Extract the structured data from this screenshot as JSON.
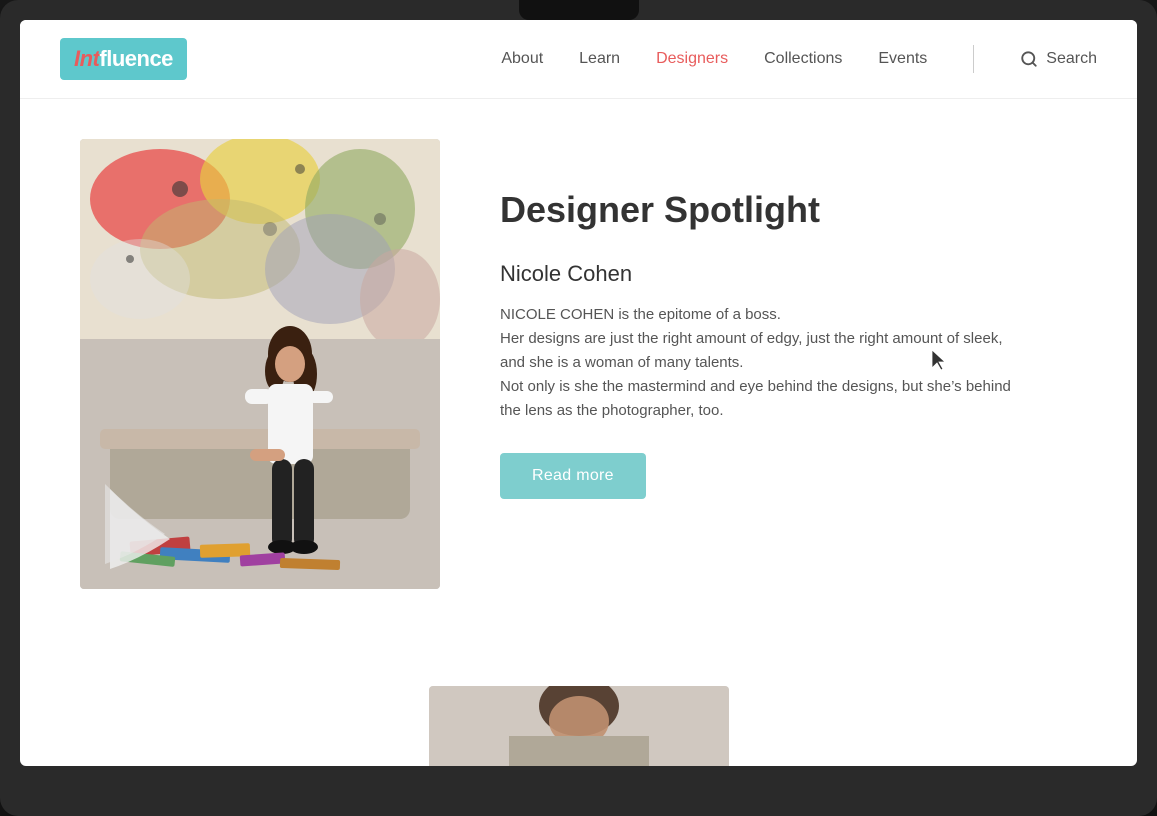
{
  "laptop": {
    "screen_bg": "#ffffff"
  },
  "nav": {
    "logo_int": "Int",
    "logo_fluence": "fluence",
    "links": [
      {
        "label": "About",
        "active": false,
        "id": "about"
      },
      {
        "label": "Learn",
        "active": false,
        "id": "learn"
      },
      {
        "label": "Designers",
        "active": true,
        "id": "designers"
      },
      {
        "label": "Collections",
        "active": false,
        "id": "collections"
      },
      {
        "label": "Events",
        "active": false,
        "id": "events"
      }
    ],
    "search_label": "Search"
  },
  "main": {
    "spotlight_title": "Designer Spotlight",
    "designer_name": "Nicole Cohen",
    "designer_bio_line1": "NICOLE COHEN is the epitome of a boss.",
    "designer_bio_line2": "Her designs are just the right amount of edgy, just the right amount of sleek,",
    "designer_bio_line3": "and she is a woman of many talents.",
    "designer_bio_line4": "Not only is she the mastermind and eye behind the designs, but she’s behind",
    "designer_bio_line5": "the lens as the photographer, too.",
    "read_more_label": "Read more"
  },
  "colors": {
    "logo_bg": "#5ec8cc",
    "logo_int": "#e85c5c",
    "nav_active": "#e85c5c",
    "read_more_bg": "#7ecece",
    "nav_text": "#555555"
  }
}
